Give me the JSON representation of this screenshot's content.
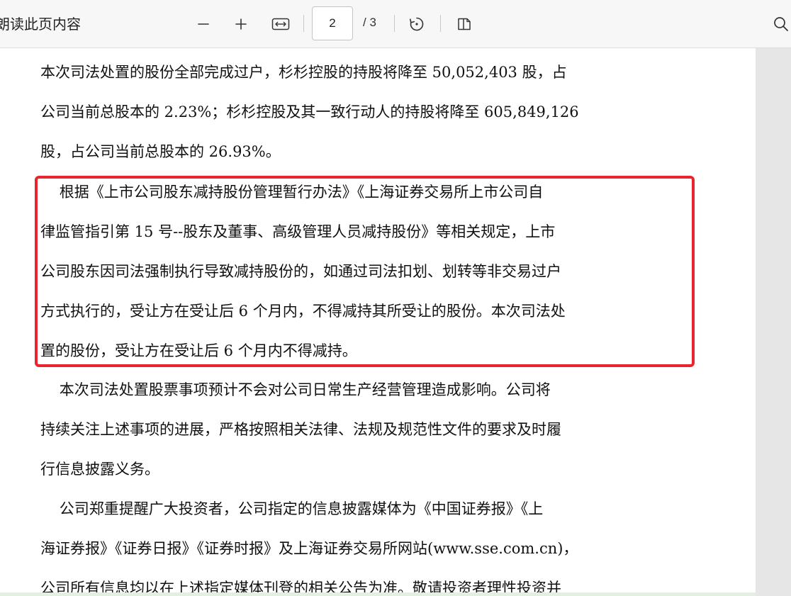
{
  "toolbar": {
    "read_aloud_label": "朗读此页内容",
    "current_page": "2",
    "total_pages": "/ 3",
    "icons": [
      "minus-icon",
      "plus-icon",
      "fit-width-icon",
      "rotate-icon",
      "two-page-view-icon",
      "search-icon"
    ]
  },
  "document": {
    "lines": [
      "本次司法处置的股份全部完成过户，杉杉控股的持股将降至 50,052,403 股，占",
      "公司当前总股本的 2.23%；杉杉控股及其一致行动人的持股将降至 605,849,126",
      "股，占公司当前总股本的 26.93%。",
      "    根据《上市公司股东减持股份管理暂行办法》《上海证券交易所上市公司自",
      "律监管指引第 15 号--股东及董事、高级管理人员减持股份》等相关规定，上市",
      "公司股东因司法强制执行导致减持股份的，如通过司法扣划、划转等非交易过户",
      "方式执行的，受让方在受让后 6 个月内，不得减持其所受让的股份。本次司法处",
      "置的股份，受让方在受让后 6 个月内不得减持。",
      "    本次司法处置股票事项预计不会对公司日常生产经营管理造成影响。公司将",
      "持续关注上述事项的进展，严格按照相关法律、法规及规范性文件的要求及时履",
      "行信息披露义务。",
      "    公司郑重提醒广大投资者，公司指定的信息披露媒体为《中国证券报》《上",
      "海证券报》《证券日报》《证券时报》及上海证券交易所网站(www.sse.com.cn)，",
      "公司所有信息均以在上述指定媒体刊登的相关公告为准。敬请投资者理性投资并"
    ]
  },
  "colors": {
    "highlight_border": "#e8242c",
    "toolbar_bg": "#f7f7f7",
    "page_bg": "#ffffff",
    "text": "#111111"
  }
}
